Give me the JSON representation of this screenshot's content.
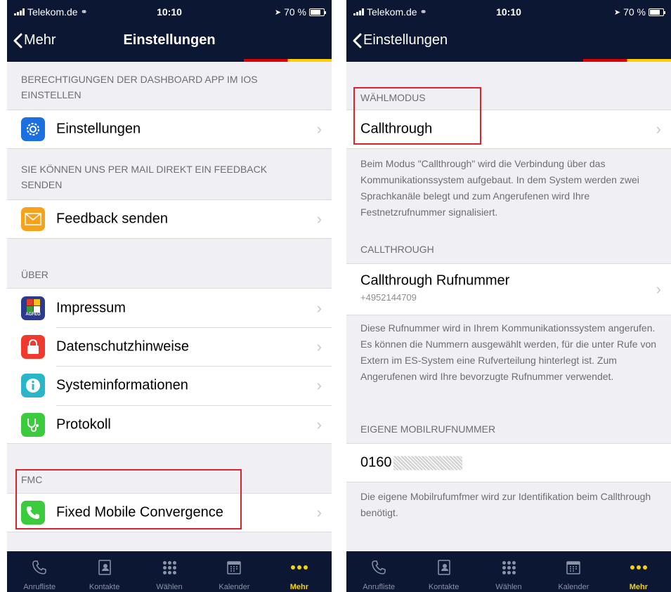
{
  "status": {
    "carrier": "Telekom.de",
    "time": "10:10",
    "battery_text": "70 %"
  },
  "left": {
    "nav": {
      "back_label": "Mehr",
      "title": "Einstellungen"
    },
    "section1_header": "BERECHTIGUNGEN DER DASHBOARD APP IM IOS EINSTELLEN",
    "settings_label": "Einstellungen",
    "section2_header": "SIE KÖNNEN UNS PER MAIL DIREKT EIN FEEDBACK SENDEN",
    "feedback_label": "Feedback senden",
    "section3_header": "ÜBER",
    "about_items": [
      {
        "label": "Impressum"
      },
      {
        "label": "Datenschutzhinweise"
      },
      {
        "label": "Systeminformationen"
      },
      {
        "label": "Protokoll"
      }
    ],
    "impressum_icon_text": "AGFEO",
    "section4_header": "FMC",
    "fmc_label": "Fixed Mobile Convergence"
  },
  "right": {
    "nav": {
      "back_label": "Einstellungen"
    },
    "dial_mode_header": "WÄHLMODUS",
    "dial_mode_value": "Callthrough",
    "dial_mode_footer": "Beim Modus \"Callthrough\" wird die Verbindung über das Kommunikationssystem aufgebaut. In dem System werden zwei Sprachkanäle belegt und zum Angerufenen wird Ihre Festnetzrufnummer signalisiert.",
    "callthrough_header": "CALLTHROUGH",
    "callthrough_number_label": "Callthrough Rufnummer",
    "callthrough_number_value": "+4952144709",
    "callthrough_footer": "Diese Rufnummer wird in Ihrem Kommunikationssystem angerufen. Es können die Nummern ausgewählt werden, für die unter Rufe von Extern im ES-System eine Rufverteilung hinterlegt ist. Zum Angerufenen wird Ihre bevorzugte Rufnummer verwendet.",
    "mobile_header": "EIGENE MOBILRUFNUMMER",
    "mobile_number_prefix": "0160",
    "mobile_footer": "Die eigene Mobilrufumfmer wird zur Identifikation beim Callthrough benötigt."
  },
  "tabs": [
    {
      "label": "Anrufliste",
      "icon": "phone-icon"
    },
    {
      "label": "Kontakte",
      "icon": "contacts-icon"
    },
    {
      "label": "Wählen",
      "icon": "keypad-icon"
    },
    {
      "label": "Kalender",
      "icon": "calendar-icon"
    },
    {
      "label": "Mehr",
      "icon": "more-icon"
    }
  ],
  "colors": {
    "nav_bg": "#0b1733",
    "tab_active": "#f5d20a",
    "highlight_box": "#d9232d",
    "flag_black": "#000000",
    "flag_red": "#dd0000",
    "flag_gold": "#ffce00"
  }
}
